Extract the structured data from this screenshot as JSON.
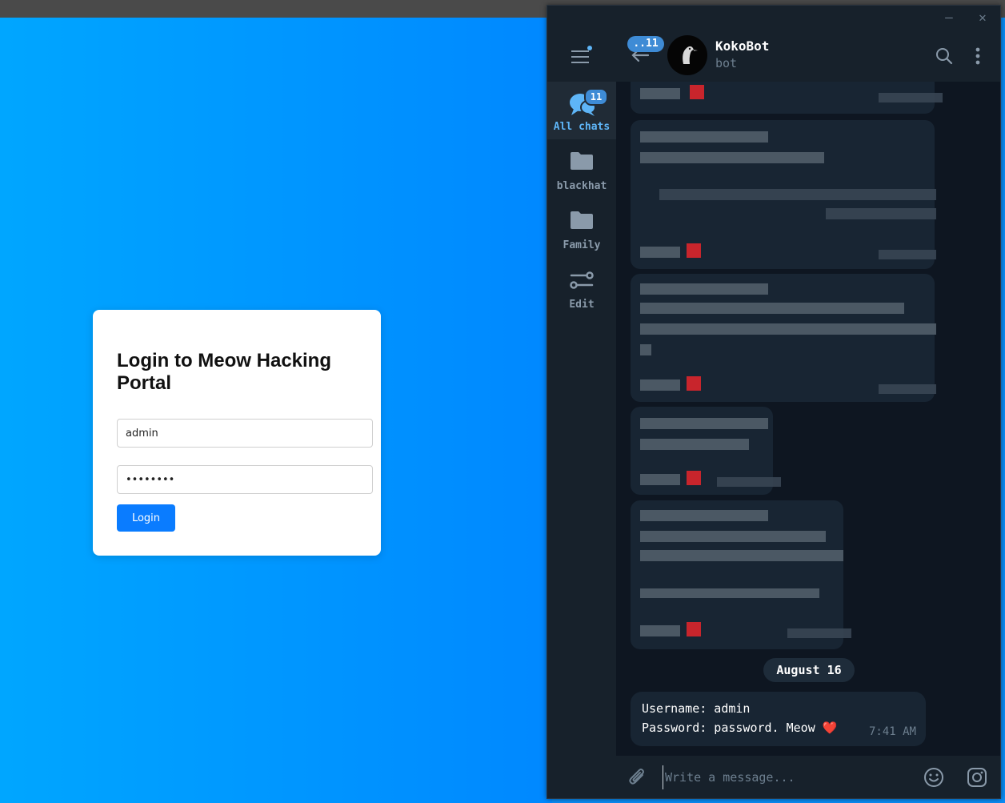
{
  "login": {
    "title": "Login to Meow Hacking Portal",
    "username_value": "admin",
    "password_value": "••••••••",
    "button_label": "Login"
  },
  "telegram": {
    "window_buttons": {
      "minimize": "–",
      "close": "✕"
    },
    "folders": [
      {
        "label": "All chats",
        "badge": "11",
        "icon": "chat-bubbles-icon"
      },
      {
        "label": "blackhat",
        "icon": "folder-icon"
      },
      {
        "label": "Family",
        "icon": "folder-icon"
      },
      {
        "label": "Edit",
        "icon": "sliders-icon"
      }
    ],
    "header": {
      "back_badge": "..11",
      "name": "KokoBot",
      "status": "bot"
    },
    "date_separator": "August 16",
    "last_message": {
      "line1": "Username: admin",
      "line2": "Password: password. Meow ❤️",
      "time": "7:41 AM"
    },
    "composer": {
      "placeholder": "Write a message..."
    },
    "colors": {
      "accent": "#5eb5f7",
      "badge": "#3e8bd5",
      "bubble": "#182533",
      "background": "#0e1621"
    }
  }
}
